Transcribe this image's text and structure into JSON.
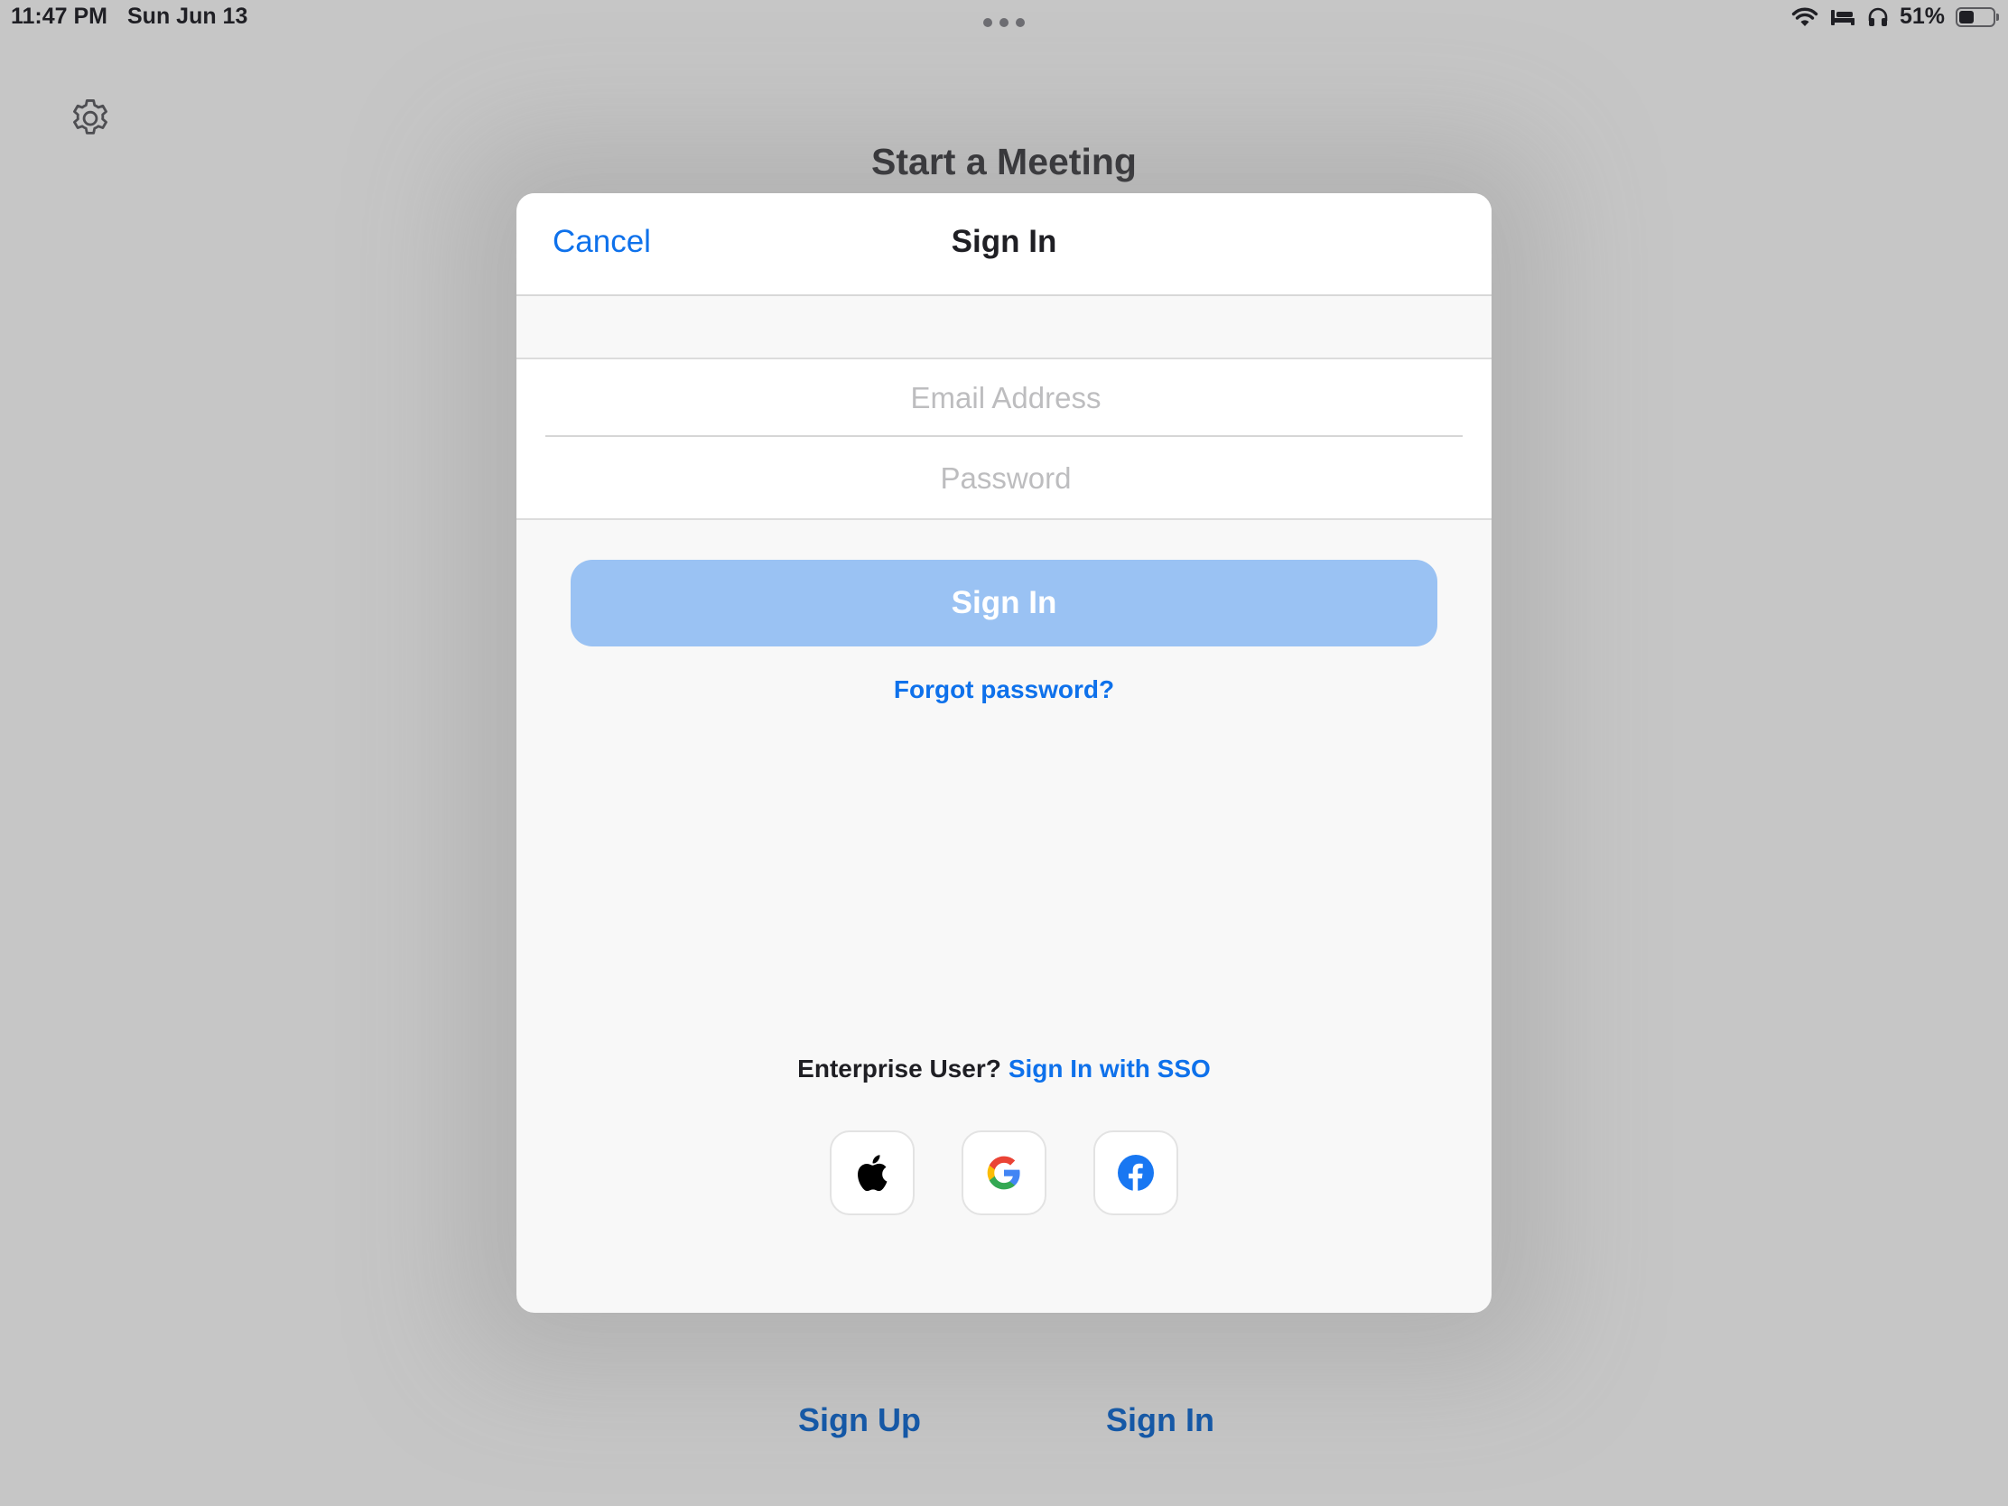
{
  "status_bar": {
    "time": "11:47 PM",
    "date": "Sun Jun 13",
    "battery_percent": "51%",
    "battery_level": 0.51,
    "icons": [
      "wifi-icon",
      "bed-icon",
      "headphones-icon",
      "battery-icon"
    ]
  },
  "background": {
    "title": "Start a Meeting",
    "settings_icon": "gear-icon",
    "bottom_links": {
      "sign_up": "Sign Up",
      "sign_in": "Sign In"
    }
  },
  "modal": {
    "cancel_label": "Cancel",
    "title": "Sign In",
    "email_placeholder": "Email Address",
    "email_value": "",
    "password_placeholder": "Password",
    "password_value": "",
    "sign_in_button": "Sign In",
    "forgot_password": "Forgot password?",
    "enterprise_label": "Enterprise User?",
    "sso_link": "Sign In with SSO",
    "social_buttons": [
      "apple-icon",
      "google-icon",
      "facebook-icon"
    ]
  },
  "colors": {
    "accent": "#0e71eb",
    "button_disabled": "#9ac2f3",
    "backdrop": "#c6c6c6",
    "link_dark": "#0f56a8"
  }
}
